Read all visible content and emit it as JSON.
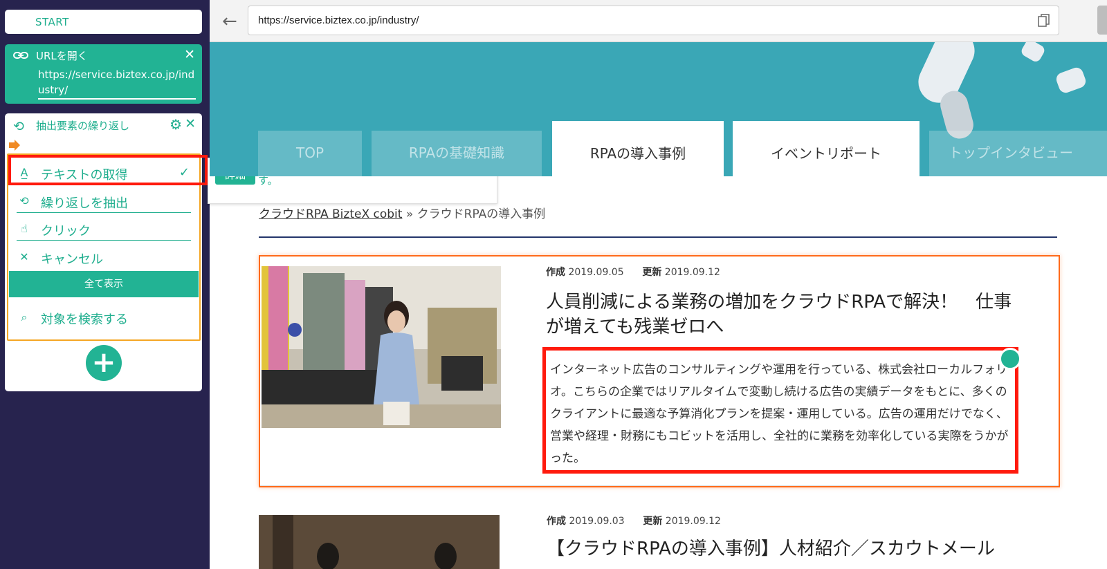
{
  "flow": {
    "start_label": "START",
    "open_url": {
      "title": "URLを開く",
      "url": "https://service.biztex.co.jp/industry/"
    },
    "loop": {
      "title": "抽出要素の繰り返し",
      "menu": [
        {
          "label": "テキストの取得",
          "icon": "text-icon",
          "checked": true
        },
        {
          "label": "繰り返しを抽出",
          "icon": "loop-icon"
        },
        {
          "label": "クリック",
          "icon": "hand-pointer-icon"
        },
        {
          "label": "キャンセル",
          "icon": "close-icon"
        }
      ],
      "show_all_label": "全て表示",
      "search_label": "対象を検索する"
    }
  },
  "tooltip": {
    "badge": "詳細",
    "text": "ブラウザ上に表示されているテキストを取得します。"
  },
  "browser": {
    "url": "https://service.biztex.co.jp/industry/"
  },
  "site": {
    "tabs": [
      {
        "label": "TOP",
        "active": false
      },
      {
        "label": "RPAの基礎知識",
        "active": false
      },
      {
        "label": "RPAの導入事例",
        "active": true
      },
      {
        "label": "イベントリポート",
        "active": true
      },
      {
        "label": "トップインタビュー",
        "active": false
      }
    ],
    "breadcrumb": {
      "link": "クラウドRPA BizteX cobit",
      "separator": "»",
      "current": "クラウドRPAの導入事例"
    },
    "articles": [
      {
        "created_label": "作成",
        "created": "2019.09.05",
        "updated_label": "更新",
        "updated": "2019.09.12",
        "title": "人員削減による業務の増加をクラウドRPAで解決！　仕事が増えても残業ゼロへ",
        "excerpt": "インターネット広告のコンサルティングや運用を行っている、株式会社ローカルフォリオ。こちらの企業ではリアルタイムで変動し続ける広告の実績データをもとに、多くのクライアントに最適な予算消化プランを提案・運用している。広告の運用だけでなく、営業や経理・財務にもコビットを活用し、全社的に業務を効率化している実際をうかがった。"
      },
      {
        "created_label": "作成",
        "created": "2019.09.03",
        "updated_label": "更新",
        "updated": "2019.09.12",
        "title": "【クラウドRPAの導入事例】人材紹介／スカウトメール"
      }
    ]
  },
  "colors": {
    "panel_bg": "#27234e",
    "accent": "#22b394",
    "highlight": "#ff1a0d",
    "menu_border": "#f5a623",
    "hero_bg": "#3aa7b6"
  }
}
